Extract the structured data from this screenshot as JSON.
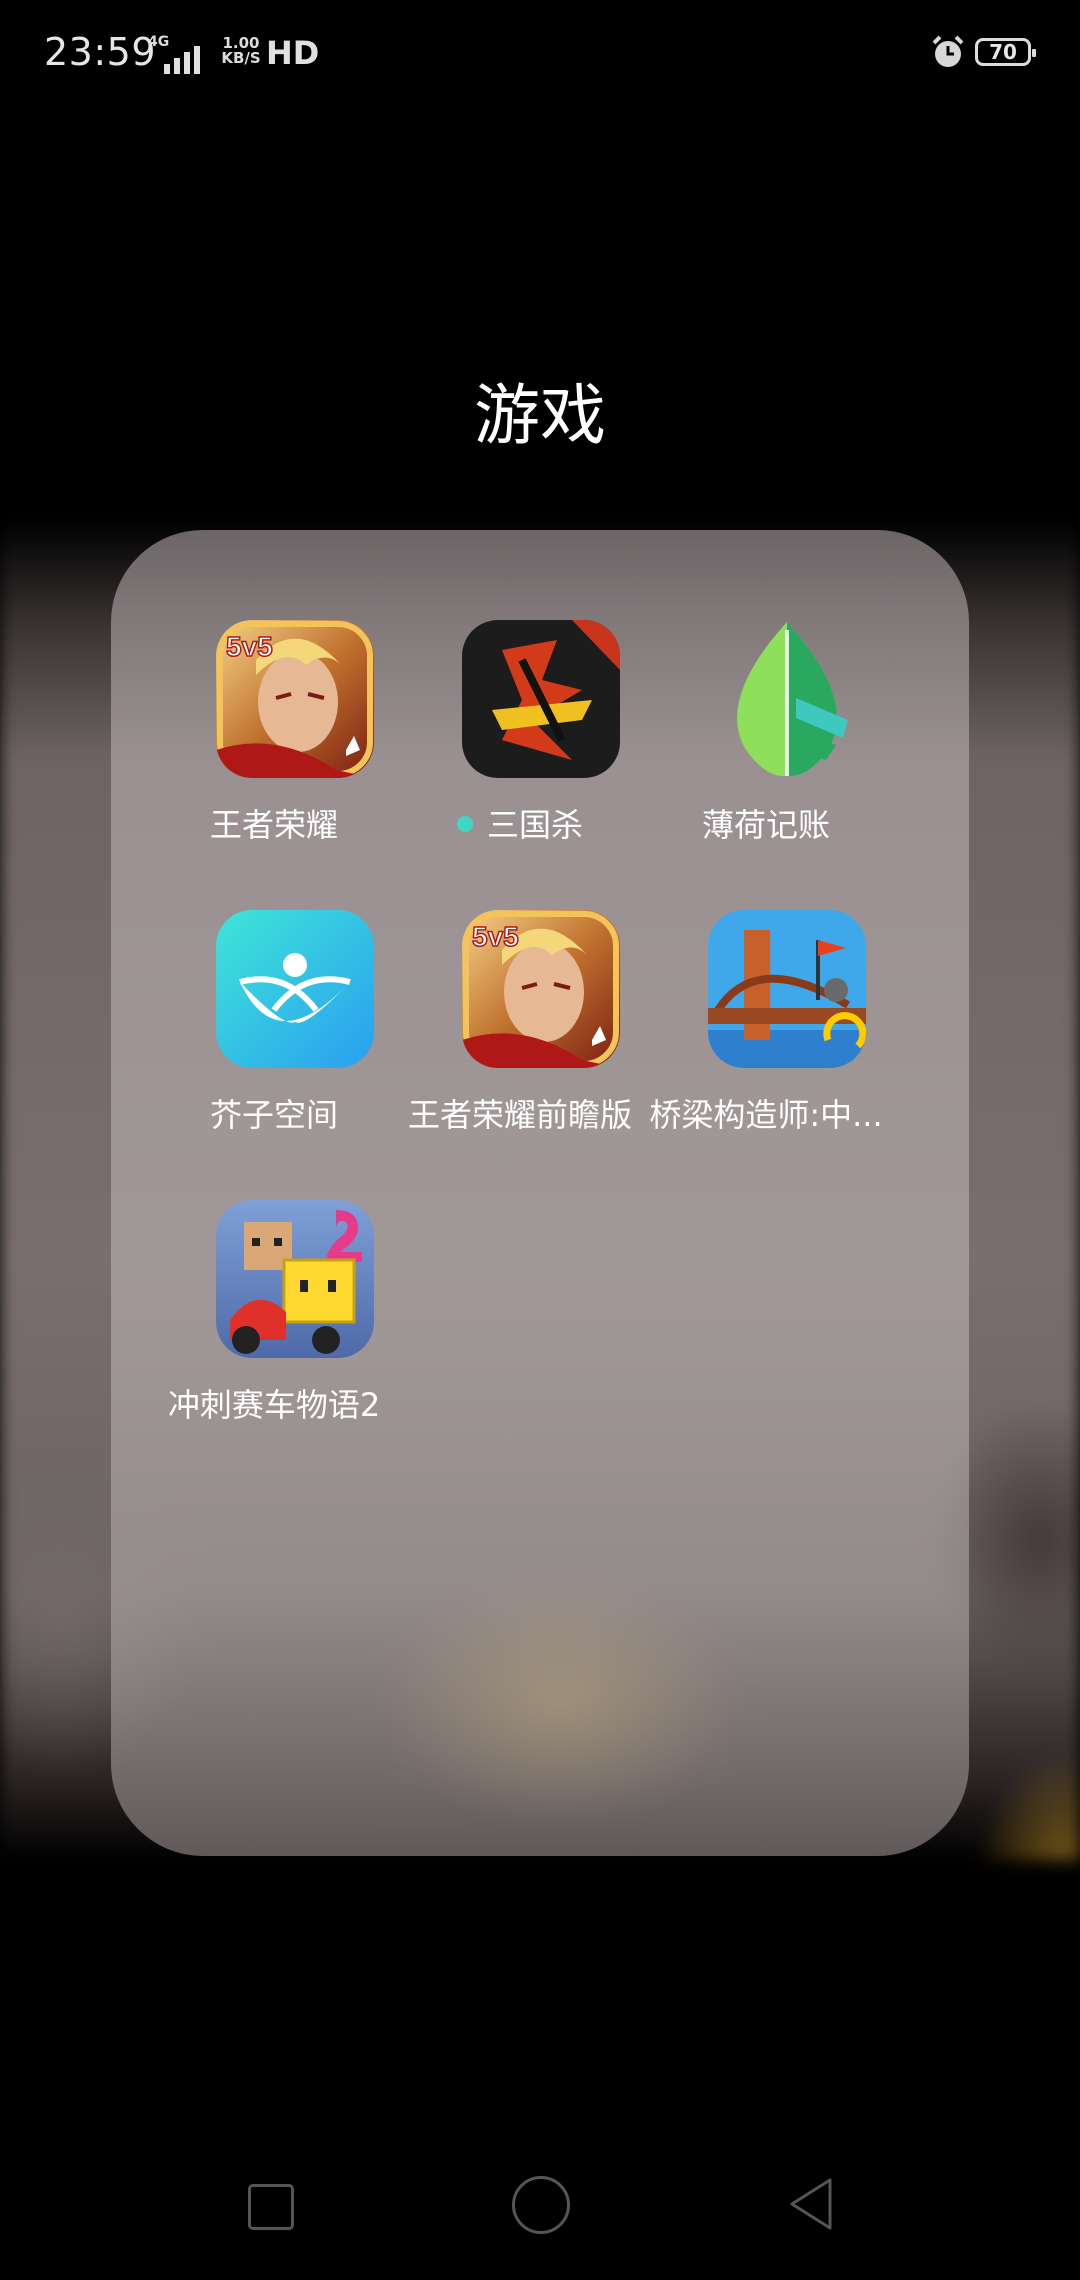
{
  "status_bar": {
    "time": "23:59",
    "network": "4G",
    "speed_value": "1.00",
    "speed_unit": "KB/S",
    "hd": "HD",
    "battery": "70",
    "alarm_icon": "alarm-clock-icon"
  },
  "folder": {
    "title": "游戏",
    "apps": [
      {
        "label": "王者荣耀",
        "icon": "honor-of-kings-icon",
        "new_dot": false
      },
      {
        "label": "三国杀",
        "icon": "sanguosha-icon",
        "new_dot": true
      },
      {
        "label": "薄荷记账",
        "icon": "mint-leaf-icon",
        "new_dot": false
      },
      {
        "label": "芥子空间",
        "icon": "jiezi-space-icon",
        "new_dot": false
      },
      {
        "label": "王者荣耀前瞻版",
        "icon": "honor-of-kings-preview-icon",
        "new_dot": false
      },
      {
        "label": "桥梁构造师:中...",
        "icon": "bridge-constructor-icon",
        "new_dot": false
      },
      {
        "label": "冲刺赛车物语2",
        "icon": "dash-racing-2-icon",
        "new_dot": false
      }
    ]
  },
  "nav": {
    "recent_icon": "square-recent-icon",
    "home_icon": "circle-home-icon",
    "back_icon": "triangle-back-icon"
  },
  "colors": {
    "new_dot": "#3fd6c6",
    "background": "#000000"
  }
}
